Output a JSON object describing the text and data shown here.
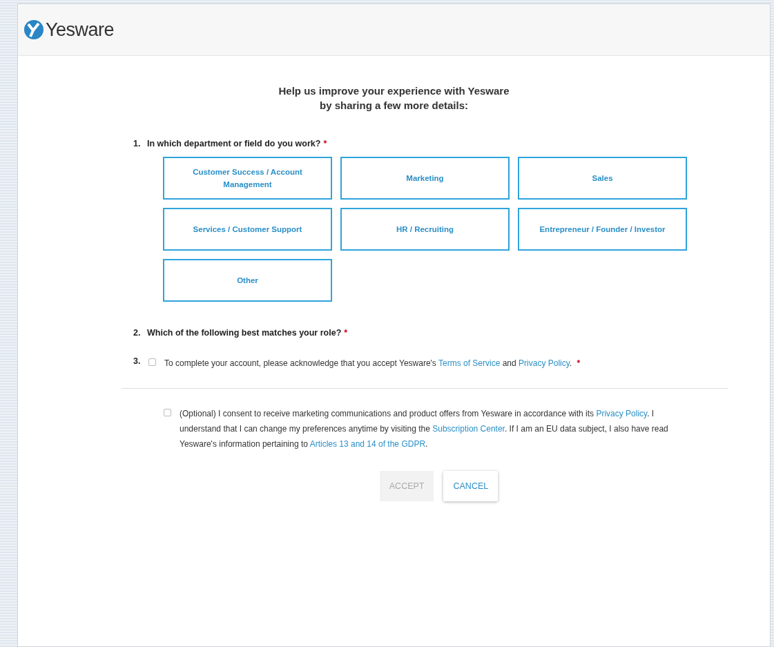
{
  "header": {
    "logo_text": "Yesware"
  },
  "intro": [
    "Help us improve your experience with Yesware",
    "by sharing a few more details:"
  ],
  "question_1": {
    "number": "1.",
    "text": "In which department or field do you work?",
    "required_mark": "*",
    "options": [
      {
        "label": "Customer Success / Account Management",
        "selected": false
      },
      {
        "label": "Marketing",
        "selected": false
      },
      {
        "label": "Sales",
        "selected": false
      },
      {
        "label": "Services / Customer Support",
        "selected": false
      },
      {
        "label": "HR / Recruiting",
        "selected": false
      },
      {
        "label": "Entrepreneur / Founder / Investor",
        "selected": false
      },
      {
        "label": "Other",
        "selected": false
      }
    ]
  },
  "question_2": {
    "number": "2.",
    "text": "Which of the following best matches your role?",
    "required_mark": "*"
  },
  "question_3": {
    "number": "3.",
    "checked": false,
    "required_mark": "*",
    "segments": [
      {
        "text": "To complete your account, please acknowledge that you accept Yesware's ",
        "link": false
      },
      {
        "text": "Terms of Service",
        "link": true
      },
      {
        "text": " and ",
        "link": false
      },
      {
        "text": "Privacy Policy",
        "link": true
      },
      {
        "text": ".",
        "link": false
      }
    ]
  },
  "optional_consent": {
    "checked": false,
    "segments": [
      {
        "text": "(Optional) I consent to receive marketing communications and product offers from Yesware in accordance with its ",
        "link": false
      },
      {
        "text": "Privacy Policy",
        "link": true
      },
      {
        "text": ". I understand that I can change my preferences anytime by visiting the ",
        "link": false
      },
      {
        "text": "Subscription Center",
        "link": true
      },
      {
        "text": ". If I am an EU data subject, I also have read Yesware's information pertaining to ",
        "link": false
      },
      {
        "text": "Articles 13 and 14 of the GDPR",
        "link": true
      },
      {
        "text": ".",
        "link": false
      }
    ]
  },
  "buttons": [
    {
      "label": "ACCEPT",
      "disabled": true
    },
    {
      "label": "CANCEL",
      "disabled": false
    }
  ]
}
